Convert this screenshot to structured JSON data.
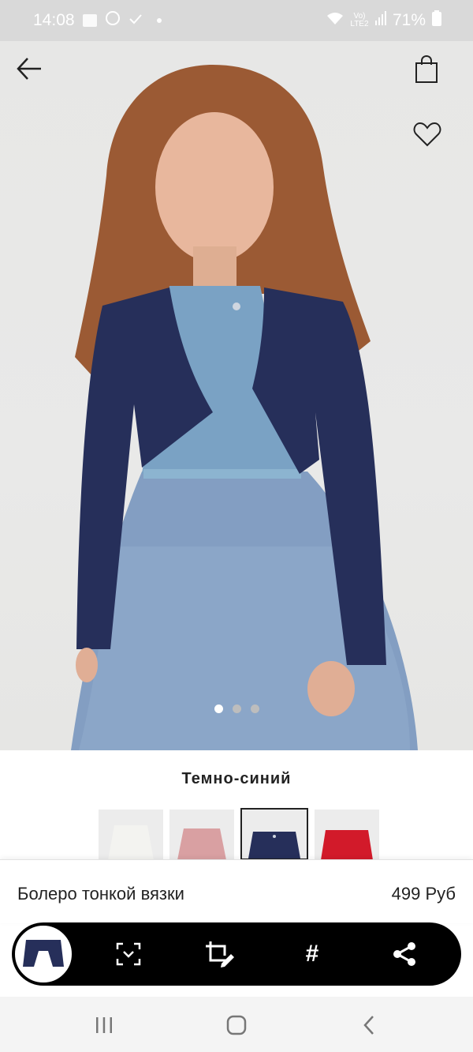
{
  "status_bar": {
    "time": "14:08",
    "network": "Vo) LTE2",
    "battery": "71%"
  },
  "hero": {
    "page_count": 3,
    "active_page": 1
  },
  "colors": {
    "accent": "#222222",
    "navy": "#262f5a",
    "toolbar_bg": "#000000"
  },
  "color_selector": {
    "selected_name": "Темно-синий",
    "swatches": [
      {
        "name": "white",
        "color": "#f3f3f0"
      },
      {
        "name": "pink",
        "color": "#d9a0a2"
      },
      {
        "name": "navy",
        "color": "#262f5a",
        "selected": true
      },
      {
        "name": "red",
        "color": "#d21a2a"
      }
    ]
  },
  "product": {
    "name": "Болеро тонкой вязки",
    "price": "499 Руб"
  },
  "toolbar": {
    "icons": [
      "scan-icon",
      "crop-edit-icon",
      "hashtag-icon",
      "share-icon"
    ],
    "hashtag_label": "#"
  }
}
